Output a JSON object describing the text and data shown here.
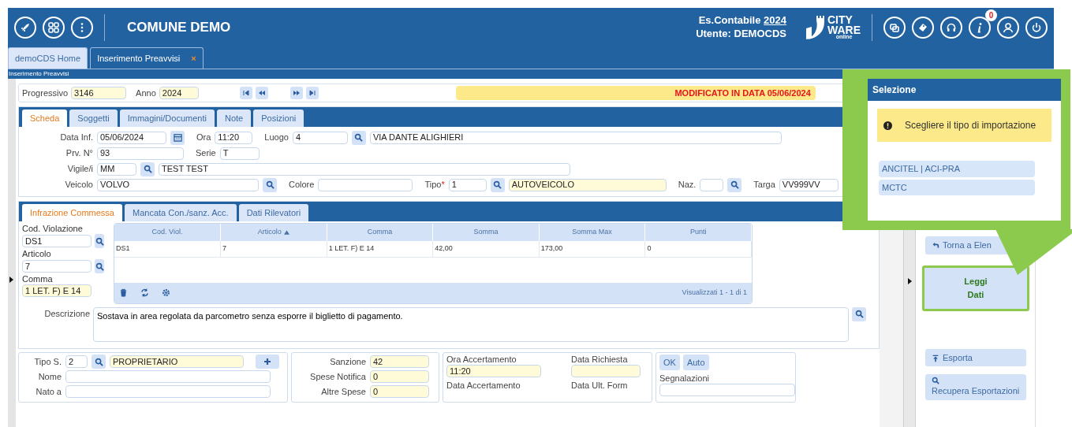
{
  "header": {
    "title": "COMUNE DEMO",
    "year_label": "Es.Contabile",
    "year": "2024",
    "user": "Utente: DEMOCDS",
    "logo": [
      "CITY",
      "WARE",
      "online"
    ],
    "notifications": "0"
  },
  "tabs": [
    {
      "label": "demoCDS Home",
      "selected": false
    },
    {
      "label": "Inserimento Preavvisi",
      "selected": true,
      "close": "×"
    }
  ],
  "breadcrumb": "Inserimento Preavvisi",
  "record": {
    "fields": [
      {
        "label": "Progressivo",
        "value": "3146"
      },
      {
        "label": "Anno",
        "value": "2024"
      }
    ],
    "status": "MODIFICATO IN DATA 05/06/2024"
  },
  "scheda_tabs": [
    {
      "label": "Scheda",
      "selected": true
    },
    {
      "label": "Soggetti",
      "selected": false
    },
    {
      "label": "Immagini/Documenti",
      "selected": false
    },
    {
      "label": "Note",
      "selected": false
    },
    {
      "label": "Posizioni",
      "selected": false
    }
  ],
  "scheda_rows": [
    [
      {
        "kind": "label",
        "text": "Data Inf."
      },
      {
        "kind": "input",
        "value": "05/06/2024",
        "readonly": false
      },
      {
        "kind": "calendar"
      },
      {
        "kind": "label",
        "text": "Ora"
      },
      {
        "kind": "input",
        "value": "11:20",
        "readonly": false
      },
      {
        "kind": "label",
        "text": "Luogo"
      },
      {
        "kind": "input",
        "value": "4",
        "readonly": false
      },
      {
        "kind": "search"
      },
      {
        "kind": "input",
        "value": "VIA DANTE ALIGHIERI",
        "readonly": false
      }
    ],
    [
      {
        "kind": "label",
        "text": "Prv. N°"
      },
      {
        "kind": "input",
        "value": "93",
        "readonly": false
      },
      {
        "kind": "label",
        "text": "Serie"
      },
      {
        "kind": "input",
        "value": "T",
        "readonly": false
      }
    ],
    [
      {
        "kind": "label",
        "text": "Vigile/i"
      },
      {
        "kind": "input",
        "value": "MM",
        "readonly": false
      },
      {
        "kind": "search"
      },
      {
        "kind": "input",
        "value": "TEST TEST",
        "readonly": false
      }
    ],
    [
      {
        "kind": "label",
        "text": "Veicolo"
      },
      {
        "kind": "input",
        "value": "VOLVO",
        "readonly": false
      },
      {
        "kind": "search"
      },
      {
        "kind": "label",
        "text": "Colore"
      },
      {
        "kind": "input",
        "readonly": false
      },
      {
        "kind": "label",
        "text": "Tipo",
        "required_mark": "*"
      },
      {
        "kind": "input",
        "value": "1",
        "readonly": false
      },
      {
        "kind": "search"
      },
      {
        "kind": "input",
        "value": "AUTOVEICOLO",
        "readonly": true
      },
      {
        "kind": "label",
        "text": "Naz."
      },
      {
        "kind": "input",
        "readonly": false
      },
      {
        "kind": "search"
      },
      {
        "kind": "label",
        "text": "Targa"
      },
      {
        "kind": "input",
        "value": "VV999VV",
        "readonly": false
      }
    ]
  ],
  "violation_tabs": [
    {
      "label": "Infrazione Commessa",
      "selected": true
    },
    {
      "label": "Mancata Con./sanz. Acc.",
      "selected": false
    },
    {
      "label": "Dati Rilevatori",
      "selected": false
    }
  ],
  "violation_fields": [
    {
      "label": "Cod. Violazione",
      "value": "DS1",
      "readonly": false,
      "searchable": true
    },
    {
      "label": "Articolo",
      "value": "7",
      "readonly": false,
      "searchable": true
    },
    {
      "label": "Comma",
      "value": "1 LET. F) E 14",
      "readonly": true,
      "searchable": false
    }
  ],
  "grid": {
    "columns": [
      {
        "label": "Cod. Viol.",
        "sorted": false
      },
      {
        "label": "Articolo",
        "sorted": true
      },
      {
        "label": "Comma",
        "sorted": false
      },
      {
        "label": "Somma",
        "sorted": false
      },
      {
        "label": "Somma Max",
        "sorted": false
      },
      {
        "label": "Punti",
        "sorted": false
      }
    ],
    "rows": [
      [
        "DS1",
        "7",
        "1 LET. F) E 14",
        "42,00",
        "173,00",
        "0"
      ]
    ],
    "footer": "Visualizzati 1 - 1 di 1"
  },
  "description": {
    "label": "Descrizione",
    "value": "Sostava in area regolata da parcometro senza esporre il biglietto di pagamento."
  },
  "subject": {
    "type_label": "Tipo S.",
    "type_code": "2",
    "type_value": "PROPRIETARIO",
    "fields": [
      {
        "label": "Nome"
      },
      {
        "label": "Nato a"
      }
    ]
  },
  "amounts": [
    {
      "label": "Sanzione",
      "value": "42"
    },
    {
      "label": "Spese Notifica",
      "value": "0"
    },
    {
      "label": "Altre Spese",
      "value": "0"
    }
  ],
  "dates": [
    [
      {
        "kind": "field",
        "label": "Ora Accertamento",
        "value": "11:20",
        "readonly": true
      },
      {
        "kind": "heading",
        "label": "Data Accertamento"
      }
    ],
    [
      {
        "kind": "field",
        "label": "Data Richiesta",
        "readonly": true
      },
      {
        "kind": "heading",
        "label": "Data Ult. Form"
      }
    ]
  ],
  "flags": {
    "buttons": [
      "OK",
      "Auto"
    ],
    "label": "Segnalazioni"
  },
  "sidebar": [
    {
      "kind": "back",
      "lines": [
        "Torna a Elen"
      ],
      "highlighted": false
    },
    {
      "kind": "plain",
      "lines": [
        "Leggi",
        "Dati"
      ],
      "highlighted": true
    },
    {
      "kind": "export",
      "lines": [
        "Esporta"
      ],
      "highlighted": false
    },
    {
      "kind": "recover",
      "lines": [
        "Recupera Esportazioni"
      ],
      "highlighted": false
    }
  ],
  "popup": {
    "title": "Selezione",
    "message": "Scegliere il tipo di importazione",
    "options": [
      "ANCITEL | ACI-PRA",
      "MCTC"
    ]
  }
}
